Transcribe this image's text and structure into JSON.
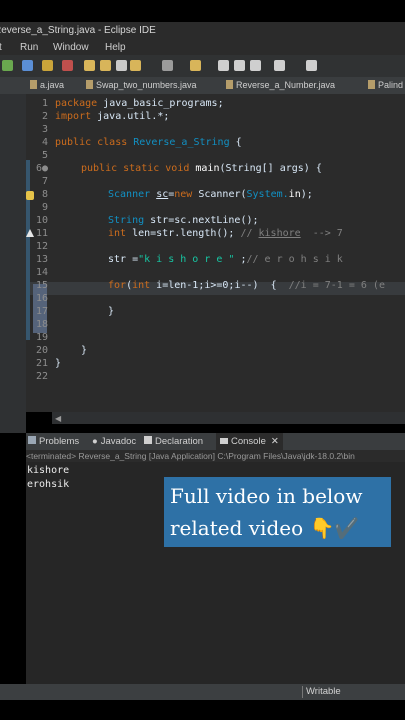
{
  "window": {
    "title": "Reverse_a_String.java - Eclipse IDE"
  },
  "menu": [
    "t",
    "Run",
    "Window",
    "Help"
  ],
  "tabs": [
    "a.java",
    "Swap_two_numbers.java",
    "Reverse_a_Number.java",
    "Palind"
  ],
  "editor": {
    "line_numbers": [
      "1",
      "2",
      "3",
      "4",
      "5",
      "6",
      "7",
      "8",
      "9",
      "10",
      "11",
      "12",
      "13",
      "14",
      "15",
      "16",
      "17",
      "18",
      "19",
      "20",
      "21",
      "22"
    ],
    "line6_marker": "6●",
    "code": {
      "l1_kw": "package",
      "l1_rest": " java_basic_programs;",
      "l2_kw": "import",
      "l2_rest": " java.util.*;",
      "l4_kw": "public class",
      "l4_cls": " Reverse_a_String",
      "l4_rest": " {",
      "l6_kw": "public static void",
      "l6_fn": " main",
      "l6_rest": "(String[] args) {",
      "l8_cls": "Scanner",
      "l8_a": " ",
      "l8_sc": "sc",
      "l8_eq": "=",
      "l8_new": "new",
      "l8_b": " Scanner(",
      "l8_sys": "System.",
      "l8_in": "in",
      "l8_c": ");",
      "l10_cls": "String",
      "l10_rest": " str=sc.nextLine();",
      "l11_kw": "int",
      "l11_rest": " len=str.length(); ",
      "l11_cm": "// ",
      "l11_cmu": "kishore",
      "l11_cm2": "  --> 7",
      "l13_a": "str =",
      "l13_str": "\"k i s h o r e \"",
      "l13_b": " ;",
      "l13_cm": "// e r o h s i k",
      "l15_kw": "for",
      "l15_a": "(",
      "l15_kw2": "int",
      "l15_b": " i=len-1;i>=0;i--)  {  ",
      "l15_cm": "//i = 7-1 = 6 (e",
      "l17": "}",
      "l20": "}",
      "l21": "}"
    }
  },
  "console_tabs": [
    "Problems",
    "Javadoc",
    "Declaration",
    "Console"
  ],
  "console": {
    "header": "<terminated> Reverse_a_String [Java Application] C:\\Program Files\\Java\\jdk-18.0.2\\bin",
    "lines": [
      "kishore",
      "erohsik"
    ]
  },
  "overlay": {
    "line1": "Full video in below",
    "line2": "related video 👇✔️"
  },
  "status": {
    "mode": "Writable"
  }
}
